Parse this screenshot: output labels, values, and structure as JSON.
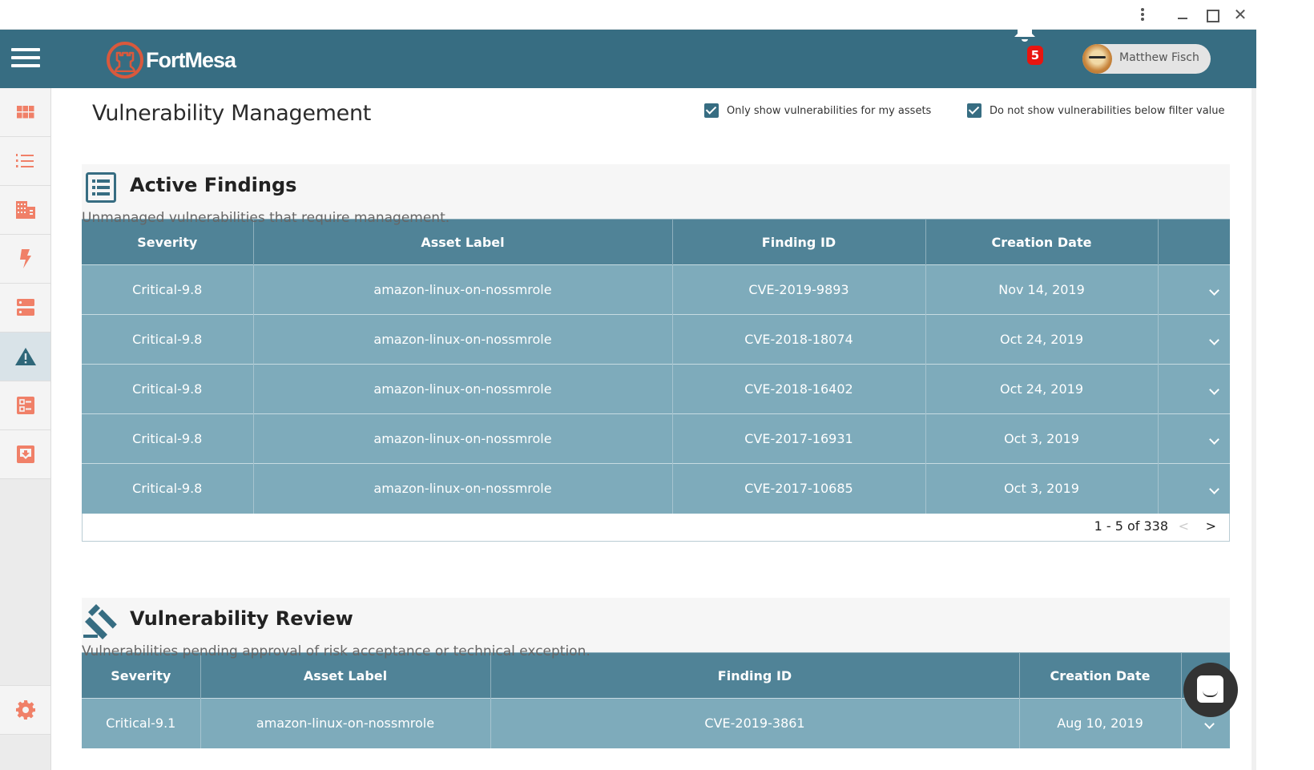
{
  "window": {
    "menu_icon": "kebab-icon",
    "minimize_icon": "minimize-icon",
    "maximize_icon": "maximize-icon",
    "close_icon": "close-icon",
    "close_glyph": "✕"
  },
  "header": {
    "brand": "FortMesa",
    "notifications_count": "5",
    "user_name": "Matthew Fisch"
  },
  "sidebar": {
    "items": [
      {
        "name": "dashboard",
        "icon": "grid-icon"
      },
      {
        "name": "lists",
        "icon": "numbered-list-icon"
      },
      {
        "name": "organizations",
        "icon": "building-icon"
      },
      {
        "name": "events",
        "icon": "lightning-icon"
      },
      {
        "name": "assets",
        "icon": "server-icon"
      },
      {
        "name": "vulnerabilities",
        "icon": "warning-icon",
        "active": true
      },
      {
        "name": "checklists",
        "icon": "checklist-icon"
      },
      {
        "name": "inbox",
        "icon": "inbox-download-icon"
      }
    ],
    "settings_icon": "gear-icon"
  },
  "page": {
    "title": "Vulnerability Management",
    "filters": [
      {
        "label": "Only show vulnerabilities for my assets",
        "checked": true
      },
      {
        "label": "Do not show vulnerabilities below filter value",
        "checked": true
      }
    ]
  },
  "active_findings": {
    "title": "Active Findings",
    "subtitle": "Unmanaged vulnerabilities that require management.",
    "columns": [
      "Severity",
      "Asset Label",
      "Finding ID",
      "Creation Date",
      ""
    ],
    "rows": [
      {
        "severity": "Critical-9.8",
        "asset": "amazon-linux-on-nossmrole",
        "finding_id": "CVE-2019-9893",
        "date": "Nov 14, 2019"
      },
      {
        "severity": "Critical-9.8",
        "asset": "amazon-linux-on-nossmrole",
        "finding_id": "CVE-2018-18074",
        "date": "Oct 24, 2019"
      },
      {
        "severity": "Critical-9.8",
        "asset": "amazon-linux-on-nossmrole",
        "finding_id": "CVE-2018-16402",
        "date": "Oct 24, 2019"
      },
      {
        "severity": "Critical-9.8",
        "asset": "amazon-linux-on-nossmrole",
        "finding_id": "CVE-2017-16931",
        "date": "Oct 3, 2019"
      },
      {
        "severity": "Critical-9.8",
        "asset": "amazon-linux-on-nossmrole",
        "finding_id": "CVE-2017-10685",
        "date": "Oct 3, 2019"
      }
    ],
    "pagination": {
      "text": "1 - 5 of 338",
      "prev": "<",
      "next": ">"
    }
  },
  "vulnerability_review": {
    "title": "Vulnerability Review",
    "subtitle": "Vulnerabilities pending approval of risk acceptance or technical exception.",
    "columns": [
      "Severity",
      "Asset Label",
      "Finding ID",
      "Creation Date",
      ""
    ],
    "rows": [
      {
        "severity": "Critical-9.1",
        "asset": "amazon-linux-on-nossmrole",
        "finding_id": "CVE-2019-3861",
        "date": "Aug 10, 2019"
      }
    ]
  },
  "chat": {
    "icon": "chat-icon"
  },
  "colors": {
    "header": "#376d82",
    "accent": "#d9593d",
    "table_header": "#508397",
    "table_row": "#7eabbb",
    "badge": "#e8150f"
  }
}
